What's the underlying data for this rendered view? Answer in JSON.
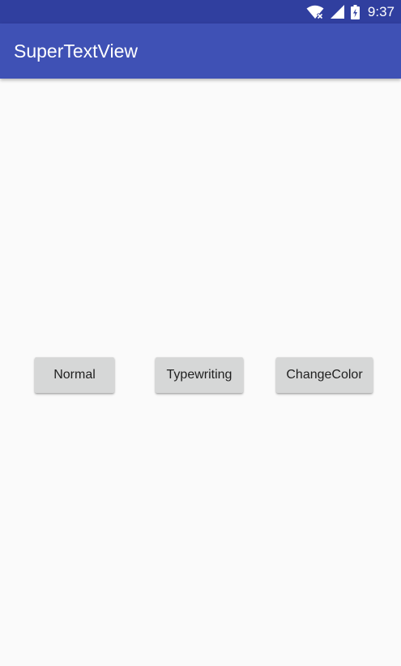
{
  "status_bar": {
    "time": "9:37",
    "icons": [
      "wifi-no-internet-icon",
      "cell-signal-icon",
      "battery-charging-icon"
    ]
  },
  "app_bar": {
    "title": "SuperTextView"
  },
  "buttons": {
    "normal": "Normal",
    "typewriting": "Typewriting",
    "change_color": "ChangeColor"
  },
  "colors": {
    "status_bar": "#303f9f",
    "app_bar": "#3f51b5",
    "background": "#fafafa",
    "button": "#d6d7d7"
  }
}
